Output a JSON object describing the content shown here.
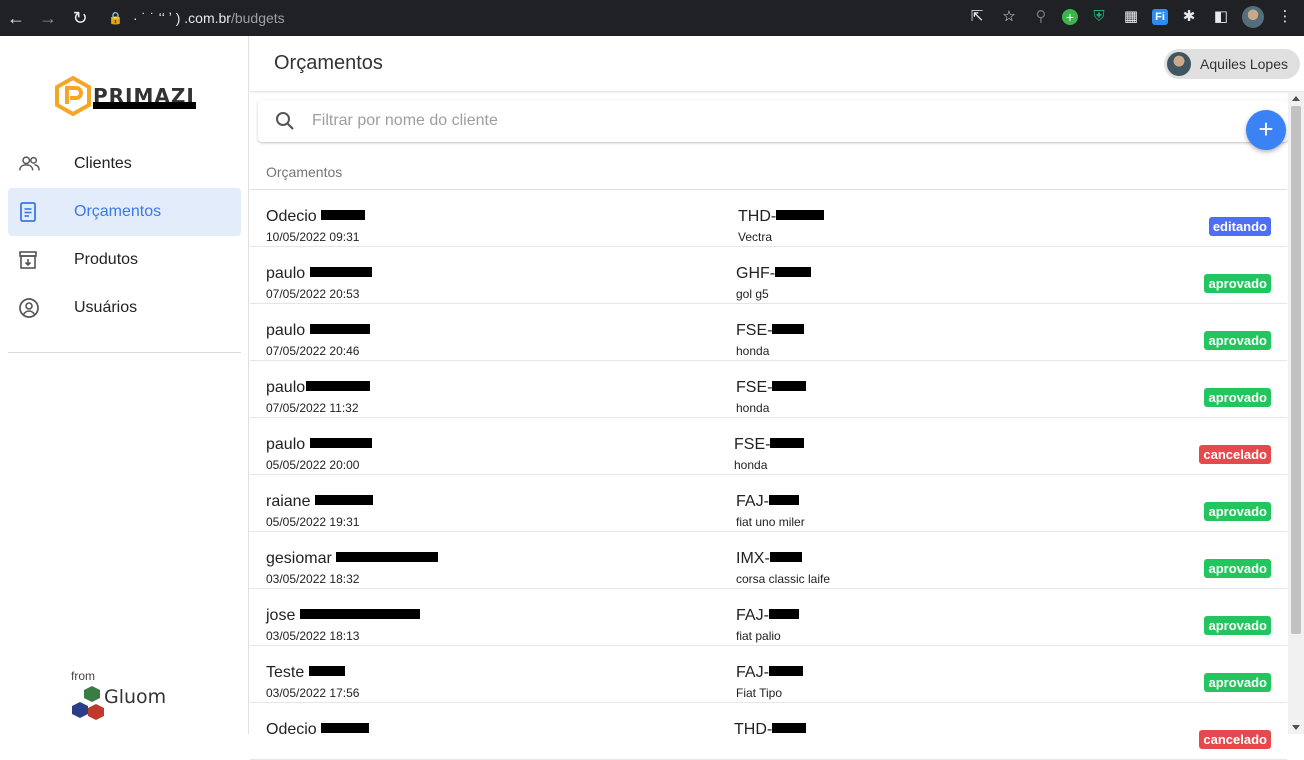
{
  "browser": {
    "url_host": "· ˙ ˙ ʻʻ ʼ ) .com.br",
    "url_path": "/budgets"
  },
  "sidebar": {
    "brand": "PRIMAZI",
    "items": [
      {
        "label": "Clientes",
        "icon": "people-icon",
        "active": false
      },
      {
        "label": "Orçamentos",
        "icon": "document-icon",
        "active": true
      },
      {
        "label": "Produtos",
        "icon": "archive-icon",
        "active": false
      },
      {
        "label": "Usuários",
        "icon": "account-circle-icon",
        "active": false
      }
    ],
    "footer_from": "from",
    "footer_brand": "Gluom"
  },
  "header": {
    "title": "Orçamentos",
    "user_name": "Aquiles Lopes"
  },
  "search": {
    "placeholder": "Filtrar por nome do cliente",
    "value": ""
  },
  "list": {
    "header": "Orçamentos",
    "rows": [
      {
        "client": "Odecio",
        "date": "10/05/2022 09:31",
        "plate": "THD-",
        "car": "Vectra",
        "status": "editando"
      },
      {
        "client": "paulo",
        "date": "07/05/2022 20:53",
        "plate": "GHF-",
        "car": "gol g5",
        "status": "aprovado"
      },
      {
        "client": "paulo",
        "date": "07/05/2022 20:46",
        "plate": "FSE-",
        "car": "honda",
        "status": "aprovado"
      },
      {
        "client": "paulo",
        "date": "07/05/2022 11:32",
        "plate": "FSE-",
        "car": "honda",
        "status": "aprovado"
      },
      {
        "client": "paulo",
        "date": "05/05/2022 20:00",
        "plate": "FSE-",
        "car": "honda",
        "status": "cancelado"
      },
      {
        "client": "raiane",
        "date": "05/05/2022 19:31",
        "plate": "FAJ-",
        "car": "fiat uno miler",
        "status": "aprovado"
      },
      {
        "client": "gesiomar",
        "date": "03/05/2022 18:32",
        "plate": "IMX-",
        "car": "corsa classic laife",
        "status": "aprovado"
      },
      {
        "client": "jose",
        "date": "03/05/2022 18:13",
        "plate": "FAJ-",
        "car": "fiat palio",
        "status": "aprovado"
      },
      {
        "client": "Teste",
        "date": "03/05/2022 17:56",
        "plate": "FAJ-",
        "car": "Fiat Tipo",
        "status": "aprovado"
      },
      {
        "client": "Odecio",
        "date": "",
        "plate": "THD-",
        "car": "",
        "status": "cancelado"
      }
    ]
  },
  "colors": {
    "accent": "#3b82f6",
    "active_bg": "#e3ecfb",
    "editando": "#4f6ef7",
    "aprovado": "#22c55e",
    "cancelado": "#e5484d"
  }
}
